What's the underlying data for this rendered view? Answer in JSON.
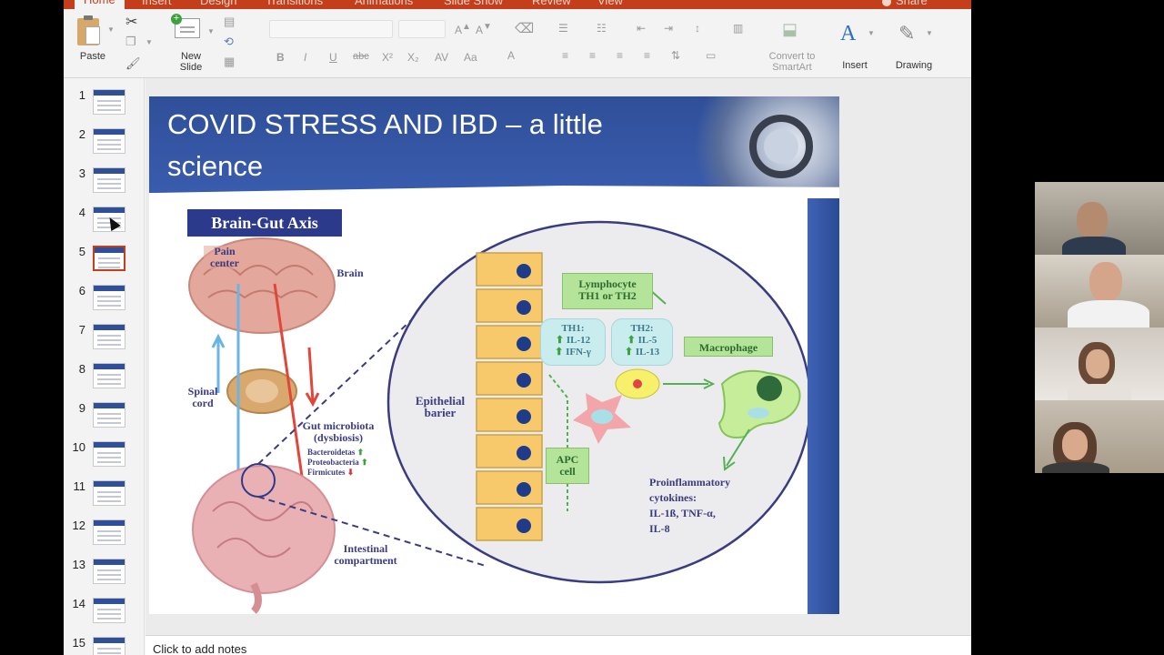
{
  "ribbon": {
    "tabs": {
      "home": "Home",
      "insert": "Insert",
      "design": "Design",
      "transitions": "Transitions",
      "animations": "Animations",
      "slideshow": "Slide Show",
      "review": "Review",
      "view": "View",
      "share": "Share"
    },
    "paste": "Paste",
    "new_slide_line1": "New",
    "new_slide_line2": "Slide",
    "convert_line1": "Convert to",
    "convert_line2": "SmartArt",
    "insert": "Insert",
    "drawing": "Drawing"
  },
  "thumbnails": [
    {
      "num": "1"
    },
    {
      "num": "2"
    },
    {
      "num": "3"
    },
    {
      "num": "4"
    },
    {
      "num": "5"
    },
    {
      "num": "6"
    },
    {
      "num": "7"
    },
    {
      "num": "8"
    },
    {
      "num": "9"
    },
    {
      "num": "10"
    },
    {
      "num": "11"
    },
    {
      "num": "12"
    },
    {
      "num": "13"
    },
    {
      "num": "14"
    },
    {
      "num": "15"
    }
  ],
  "selected_slide": 5,
  "slide": {
    "title_line1": "COVID STRESS AND IBD – a little",
    "title_line2": "science",
    "figure": {
      "heading": "Brain-Gut Axis",
      "pain_center": "Pain center",
      "brain": "Brain",
      "spinal_cord": "Spinal cord",
      "gut_microbiota": "Gut microbiota (dysbiosis)",
      "bacteroidetes": "Bacteroidetas",
      "proteobacteria": "Proteobacteria",
      "firmicutes": "Firmicutes",
      "intestinal": "Intestinal compartment",
      "epithelial": "Epithelial barier",
      "lymphocyte_line1": "Lymphocyte",
      "lymphocyte_line2": "TH1 or TH2",
      "th1_title": "TH1:",
      "th1_a": "IL-12",
      "th1_b": "IFN-γ",
      "th2_title": "TH2:",
      "th2_a": "IL-5",
      "th2_b": "IL-13",
      "macrophage": "Macrophage",
      "apc_line1": "APC",
      "apc_line2": "cell",
      "pro_line1": "Proinflammatory",
      "pro_line2": "cytokines:",
      "pro_line3": "IL-1ß, TNF-α,",
      "pro_line4": "IL-8"
    }
  },
  "notes_placeholder": "Click to add notes",
  "colors": {
    "ribbon_accent": "#c43e1c",
    "title_band": "#2f4f99",
    "cell_fill": "#f7c96a"
  }
}
